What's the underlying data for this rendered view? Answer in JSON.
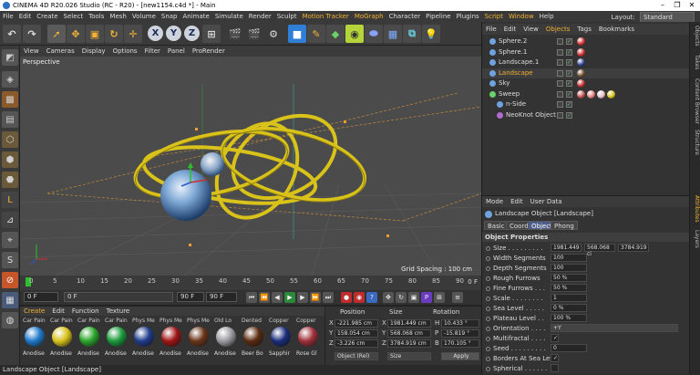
{
  "window": {
    "title": "CINEMA 4D R20.026 Studio (RC - R20) - [new1154.c4d *] - Main"
  },
  "menubar": {
    "items": [
      "File",
      "Edit",
      "Create",
      "Select",
      "Tools",
      "Mesh",
      "Volume",
      "Snap",
      "Animate",
      "Simulate",
      "Render",
      "Sculpt",
      "Motion Tracker",
      "MoGraph",
      "Character",
      "Pipeline",
      "Plugins",
      "Script",
      "Window",
      "Help"
    ],
    "layout_label": "Layout:",
    "layout_value": "Standard"
  },
  "viewport": {
    "menu": [
      "View",
      "Cameras",
      "Display",
      "Options",
      "Filter",
      "Panel",
      "ProRender"
    ],
    "label": "Perspective",
    "grid_spacing": "Grid Spacing : 100 cm"
  },
  "timeline": {
    "ticks": [
      "0",
      "5",
      "10",
      "15",
      "20",
      "25",
      "30",
      "35",
      "40",
      "45",
      "50",
      "55",
      "60",
      "65",
      "70",
      "75",
      "80",
      "85",
      "90"
    ],
    "frame_end": "0 F"
  },
  "transport": {
    "start": "0 F",
    "current": "0 F",
    "end": "90 F",
    "end2": "90 F"
  },
  "materials": {
    "menu": [
      "Create",
      "Edit",
      "Function",
      "Texture"
    ],
    "items": [
      {
        "top": "Car Pain",
        "label": "Anodise",
        "color": "#1e78c8"
      },
      {
        "top": "Car Pain",
        "label": "Anodise",
        "color": "#d7c21c"
      },
      {
        "top": "Car Pain",
        "label": "Anodise",
        "color": "#2aa52a"
      },
      {
        "top": "Car Pain",
        "label": "Anodise",
        "color": "#1a9a3a"
      },
      {
        "top": "Phys Me",
        "label": "Anodise",
        "color": "#1f3c8c"
      },
      {
        "top": "Phys Me",
        "label": "Anodise",
        "color": "#a01414"
      },
      {
        "top": "Phys Me",
        "label": "Anodise",
        "color": "#6a3418"
      },
      {
        "top": "Old Lo",
        "label": "Anodise",
        "color": "#9a9aa0"
      },
      {
        "top": "Dented",
        "label": "Beer Bo",
        "color": "#5a2c10"
      },
      {
        "top": "Copper",
        "label": "Sapphir",
        "color": "#1a2c7a"
      },
      {
        "top": "Copper",
        "label": "Rose Gl",
        "color": "#a0303a"
      }
    ]
  },
  "coordinates": {
    "headers": [
      "Position",
      "Size",
      "Rotation"
    ],
    "rows": [
      {
        "axis": "X",
        "pos": "-221.985 cm",
        "size_axis": "X",
        "size": "1981.449 cm",
        "rot_axis": "H",
        "rot": "10.433 °"
      },
      {
        "axis": "Y",
        "pos": "158.054 cm",
        "size_axis": "Y",
        "size": "568.068 cm",
        "rot_axis": "P",
        "rot": "-15.819 °"
      },
      {
        "axis": "Z",
        "pos": "-3.226 cm",
        "size_axis": "Z",
        "size": "3784.919 cm",
        "rot_axis": "B",
        "rot": "170.105 °"
      }
    ],
    "mode": "Object (Rel)",
    "size_mode": "Size",
    "apply": "Apply"
  },
  "status": {
    "text": "Landscape Object [Landscape]"
  },
  "objects": {
    "tabs": [
      "File",
      "Edit",
      "View",
      "Objects",
      "Tags",
      "Bookmarks"
    ],
    "active_tab": "Objects",
    "items": [
      {
        "name": "Sphere.2",
        "indent": 0,
        "color": "#6fa3e0",
        "highlight": false
      },
      {
        "name": "Sphere.1",
        "indent": 0,
        "color": "#6fa3e0",
        "highlight": false
      },
      {
        "name": "Landscape.1",
        "indent": 0,
        "color": "#6fa3e0",
        "highlight": false
      },
      {
        "name": "Landscape",
        "indent": 0,
        "color": "#6fa3e0",
        "highlight": true
      },
      {
        "name": "Sky",
        "indent": 0,
        "color": "#6fa3e0",
        "highlight": false
      },
      {
        "name": "Sweep",
        "indent": 0,
        "color": "#6ad06a",
        "highlight": false
      },
      {
        "name": "n-Side",
        "indent": 1,
        "color": "#6fa3e0",
        "highlight": false
      },
      {
        "name": "NeoKnot Object",
        "indent": 1,
        "color": "#b06ad0",
        "highlight": false
      }
    ]
  },
  "attributes": {
    "menu": [
      "Mode",
      "Edit",
      "User Data"
    ],
    "title": "Landscape Object [Landscape]",
    "tabs": [
      "Basic",
      "Coord.",
      "Object",
      "Phong"
    ],
    "active_tab": "Object",
    "section": "Object Properties",
    "props": [
      {
        "label": "Size . . . . . . . . .",
        "v1": "1981.449",
        "v2": "568.068 ci",
        "v3": "3784.919"
      },
      {
        "label": "Width Segments",
        "v1": "100"
      },
      {
        "label": "Depth Segments",
        "v1": "100"
      },
      {
        "label": "Rough Furrows",
        "v1": "50 %"
      },
      {
        "label": "Fine Furrows . . .",
        "v1": "50 %"
      },
      {
        "label": "Scale . . . . . . . .",
        "v1": "1"
      },
      {
        "label": "Sea Level . . . . .",
        "v1": "0 %"
      },
      {
        "label": "Plateau Level . .",
        "v1": "100 %"
      },
      {
        "label": "Orientation . . . .",
        "v1": "+Y"
      },
      {
        "label": "Multifractal . . . .",
        "v1": "✓"
      },
      {
        "label": "Seed . . . . . . . . .",
        "v1": "0"
      },
      {
        "label": "Borders At Sea Level",
        "v1": "✓"
      },
      {
        "label": "Spherical . . . . . .",
        "v1": ""
      }
    ]
  },
  "sidetabs": [
    "Objects",
    "Takes",
    "Content Browser",
    "Structure",
    "Attributes",
    "Layers"
  ]
}
